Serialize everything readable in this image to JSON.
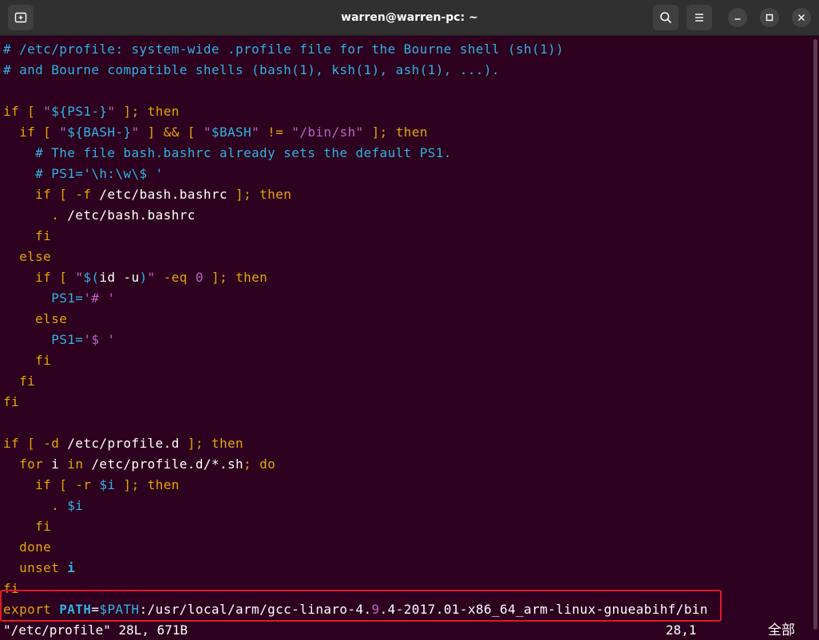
{
  "window": {
    "title": "warren@warren-pc: ~",
    "icons": [
      "new-tab-icon",
      "search-icon",
      "menu-icon",
      "minimize-icon",
      "maximize-icon",
      "close-icon"
    ]
  },
  "colors": {
    "background": "#2c001e",
    "comment": "#34b2e3",
    "keyword": "#e5a50a",
    "string": "#c061cb",
    "highlight_box": "#e01b24"
  },
  "editor": {
    "lines": [
      [
        {
          "t": "# /etc/profile: system-wide .profile file for the Bourne shell (sh(1))",
          "c": "comment"
        }
      ],
      [
        {
          "t": "# and Bourne compatible shells (bash(1), ksh(1), ash(1), ...).",
          "c": "comment"
        }
      ],
      [],
      [
        {
          "t": "if",
          "c": "kw"
        },
        {
          "t": " [ ",
          "c": "kw"
        },
        {
          "t": "\"",
          "c": "str"
        },
        {
          "t": "${PS1-}",
          "c": "var"
        },
        {
          "t": "\"",
          "c": "str"
        },
        {
          "t": " ]; ",
          "c": "kw"
        },
        {
          "t": "then",
          "c": "kw"
        }
      ],
      [
        {
          "t": "  if",
          "c": "kw"
        },
        {
          "t": " [ ",
          "c": "kw"
        },
        {
          "t": "\"",
          "c": "str"
        },
        {
          "t": "${BASH-}",
          "c": "var"
        },
        {
          "t": "\"",
          "c": "str"
        },
        {
          "t": " ] && [ ",
          "c": "kw"
        },
        {
          "t": "\"",
          "c": "str"
        },
        {
          "t": "$BASH",
          "c": "var"
        },
        {
          "t": "\"",
          "c": "str"
        },
        {
          "t": " != ",
          "c": "kw"
        },
        {
          "t": "\"/bin/sh\"",
          "c": "str"
        },
        {
          "t": " ]; ",
          "c": "kw"
        },
        {
          "t": "then",
          "c": "kw"
        }
      ],
      [
        {
          "t": "    # The file bash.bashrc already sets the default PS1.",
          "c": "comment"
        }
      ],
      [
        {
          "t": "    # PS1='\\h:\\w\\$ '",
          "c": "comment"
        }
      ],
      [
        {
          "t": "    if",
          "c": "kw"
        },
        {
          "t": " [ ",
          "c": "kw"
        },
        {
          "t": "-f",
          "c": "kw"
        },
        {
          "t": " /etc/bash.bashrc",
          "c": "plain"
        },
        {
          "t": " ]; ",
          "c": "kw"
        },
        {
          "t": "then",
          "c": "kw"
        }
      ],
      [
        {
          "t": "      . ",
          "c": "kw"
        },
        {
          "t": "/etc/bash.bashrc",
          "c": "plain"
        }
      ],
      [
        {
          "t": "    fi",
          "c": "kw"
        }
      ],
      [
        {
          "t": "  else",
          "c": "kw"
        }
      ],
      [
        {
          "t": "    if",
          "c": "kw"
        },
        {
          "t": " [ ",
          "c": "kw"
        },
        {
          "t": "\"",
          "c": "str"
        },
        {
          "t": "$(",
          "c": "var"
        },
        {
          "t": "id -u",
          "c": "plain"
        },
        {
          "t": ")",
          "c": "var"
        },
        {
          "t": "\"",
          "c": "str"
        },
        {
          "t": " -eq ",
          "c": "kw"
        },
        {
          "t": "0",
          "c": "str"
        },
        {
          "t": " ]; ",
          "c": "kw"
        },
        {
          "t": "then",
          "c": "kw"
        }
      ],
      [
        {
          "t": "      PS1=",
          "c": "var"
        },
        {
          "t": "'# '",
          "c": "str"
        }
      ],
      [
        {
          "t": "    else",
          "c": "kw"
        }
      ],
      [
        {
          "t": "      PS1=",
          "c": "var"
        },
        {
          "t": "'$ '",
          "c": "str"
        }
      ],
      [
        {
          "t": "    fi",
          "c": "kw"
        }
      ],
      [
        {
          "t": "  fi",
          "c": "kw"
        }
      ],
      [
        {
          "t": "fi",
          "c": "kw"
        }
      ],
      [],
      [
        {
          "t": "if",
          "c": "kw"
        },
        {
          "t": " [ ",
          "c": "kw"
        },
        {
          "t": "-d",
          "c": "kw"
        },
        {
          "t": " /etc/profile.d",
          "c": "plain"
        },
        {
          "t": " ]; ",
          "c": "kw"
        },
        {
          "t": "then",
          "c": "kw"
        }
      ],
      [
        {
          "t": "  for",
          "c": "kw"
        },
        {
          "t": " i ",
          "c": "plain"
        },
        {
          "t": "in",
          "c": "kw"
        },
        {
          "t": " /etc/profile.d/*.sh",
          "c": "plain"
        },
        {
          "t": "; ",
          "c": "kw"
        },
        {
          "t": "do",
          "c": "kw"
        }
      ],
      [
        {
          "t": "    if",
          "c": "kw"
        },
        {
          "t": " [ ",
          "c": "kw"
        },
        {
          "t": "-r",
          "c": "kw"
        },
        {
          "t": " ",
          "c": "plain"
        },
        {
          "t": "$i",
          "c": "var"
        },
        {
          "t": " ]; ",
          "c": "kw"
        },
        {
          "t": "then",
          "c": "kw"
        }
      ],
      [
        {
          "t": "      . ",
          "c": "kw"
        },
        {
          "t": "$i",
          "c": "var"
        }
      ],
      [
        {
          "t": "    fi",
          "c": "kw"
        }
      ],
      [
        {
          "t": "  done",
          "c": "kw"
        }
      ],
      [
        {
          "t": "  unset ",
          "c": "kw"
        },
        {
          "t": "i",
          "c": "bold"
        }
      ],
      [
        {
          "t": "fi",
          "c": "kw"
        }
      ],
      [
        {
          "t": "export ",
          "c": "kw"
        },
        {
          "t": "PATH",
          "c": "bold"
        },
        {
          "t": "=",
          "c": "plain"
        },
        {
          "t": "$PATH",
          "c": "var"
        },
        {
          "t": ":/usr/local/arm/gcc-linaro-4.",
          "c": "plain"
        },
        {
          "t": "9",
          "c": "str"
        },
        {
          "t": ".4-2017.01-x86_64_arm-linux-gnueabihf/bin",
          "c": "plain"
        }
      ]
    ],
    "status": {
      "file": "\"/etc/profile\" 28L, 671B",
      "position": "28,1",
      "scroll": "全部"
    }
  }
}
